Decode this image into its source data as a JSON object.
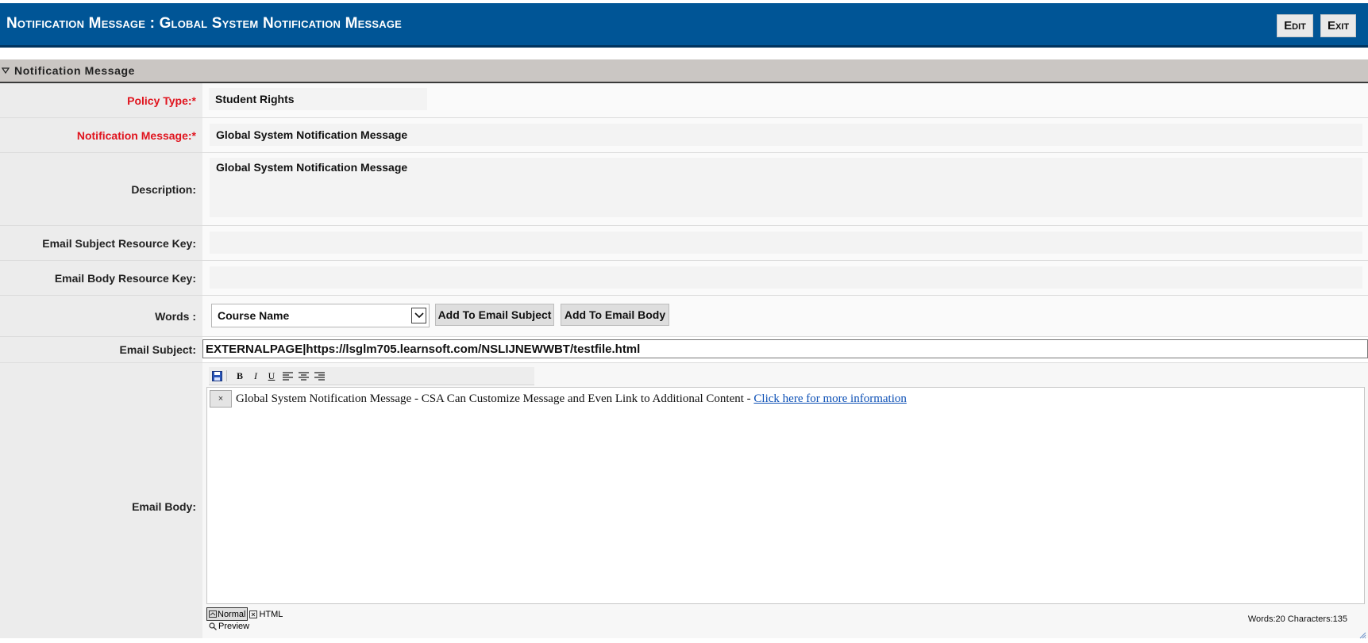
{
  "header": {
    "title": "Notification Message : Global System Notification Message",
    "edit_label": "Edit",
    "exit_label": "Exit"
  },
  "section": {
    "title": "Notification Message"
  },
  "form": {
    "policy_type": {
      "label": "Policy Type:*",
      "value": "Student Rights"
    },
    "notification_message": {
      "label": "Notification Message:*",
      "value": "Global System Notification Message"
    },
    "description": {
      "label": "Description:",
      "value": "Global System Notification Message"
    },
    "email_subject_resource_key": {
      "label": "Email Subject Resource Key:",
      "value": ""
    },
    "email_body_resource_key": {
      "label": "Email Body Resource Key:",
      "value": ""
    },
    "words": {
      "label": "Words :",
      "selected": "Course Name",
      "add_subject_label": "Add To Email Subject",
      "add_body_label": "Add To Email Body"
    },
    "email_subject": {
      "label": "Email Subject:",
      "value": "EXTERNALPAGE|https://lsglm705.learnsoft.com/NSLIJNEWWBT/testfile.html"
    },
    "email_body": {
      "label": "Email Body:",
      "remove_glyph": "×",
      "text": "Global System Notification Message - CSA Can Customize Message and Even Link to Additional Content - ",
      "link_text": "Click here for more information",
      "mode_normal": "Normal",
      "mode_html": "HTML",
      "preview_label": "Preview",
      "counts": "Words:20 Characters:135"
    }
  },
  "toolbar_icons": [
    "save-icon",
    "bold-icon",
    "italic-icon",
    "underline-icon",
    "align-left-icon",
    "align-center-icon",
    "align-right-icon"
  ],
  "colors": {
    "header_bg": "#005596",
    "section_bg": "#cac6c3",
    "required_label": "#e0141e",
    "link": "#0b4fb5"
  }
}
